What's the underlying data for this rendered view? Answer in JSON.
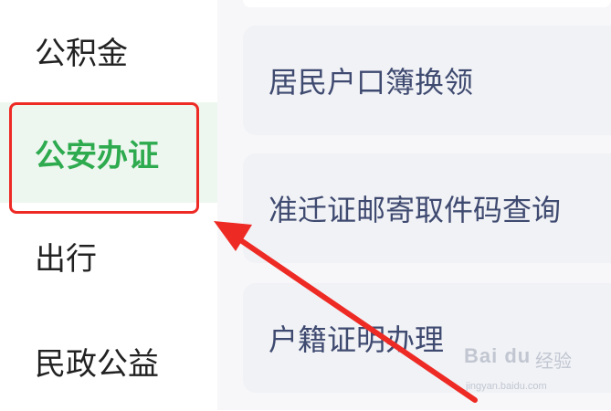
{
  "sidebar": {
    "items": [
      {
        "label": "公积金",
        "active": false
      },
      {
        "label": "公安办证",
        "active": true
      },
      {
        "label": "出行",
        "active": false
      },
      {
        "label": "民政公益",
        "active": false
      }
    ]
  },
  "main": {
    "services": [
      {
        "label": "居民户口簿换领"
      },
      {
        "label": "准迁证邮寄取件码查询"
      },
      {
        "label": "户籍证明办理"
      }
    ]
  },
  "annotation": {
    "highlight_color": "#ee2a25",
    "arrow_color": "#ee2a25"
  },
  "watermark": {
    "logo": "Bai du",
    "text": "经验",
    "url": "jingyan.baidu.com"
  },
  "colors": {
    "active_text": "#2eaa4f",
    "active_bg": "#eef7ef",
    "card_bg": "#f1f2f6",
    "card_text": "#3f4a70"
  }
}
